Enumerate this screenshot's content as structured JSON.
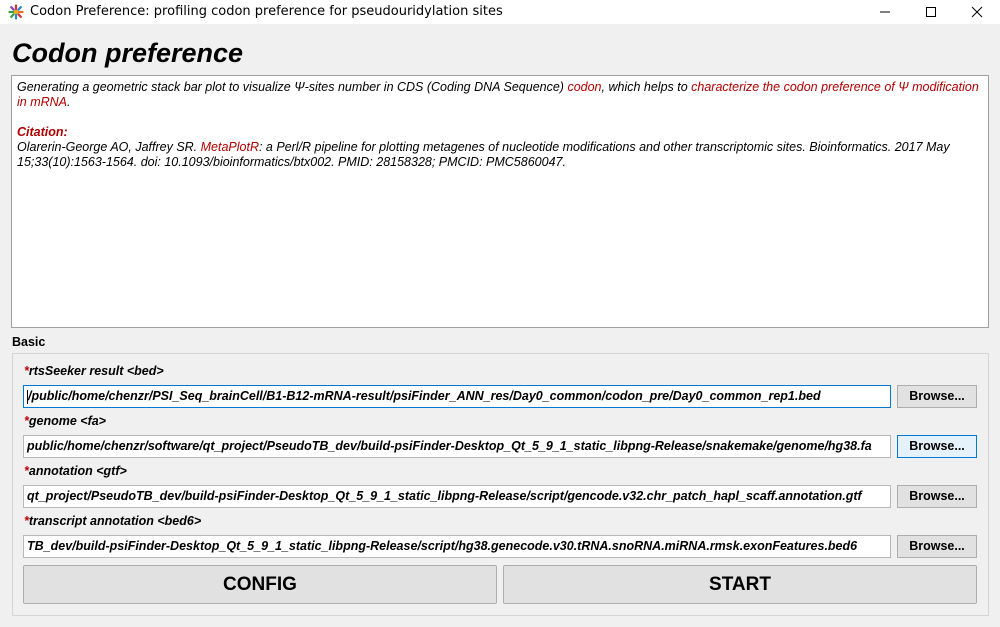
{
  "window": {
    "title": "Codon Preference: profiling codon preference for pseudouridylation sites"
  },
  "page": {
    "title": "Codon preference"
  },
  "description": {
    "line1_a": "Generating a geometric stack bar plot to visualize Ψ-sites number in CDS (Coding DNA Sequence) ",
    "line1_codon": "codon",
    "line1_b": ", which helps to ",
    "line1_char": "characterize the codon preference of Ψ modification in mRNA",
    "line1_end": ".",
    "citation_label": "Citation:",
    "citation_authors": "Olarerin-George AO, Jaffrey SR. ",
    "citation_tool": "MetaPlotR",
    "citation_rest": ": a Perl/R pipeline for plotting metagenes of nucleotide modifications and other transcriptomic sites. Bioinformatics. 2017 May 15;33(10):1563-1564. doi: 10.1093/bioinformatics/btx002. PMID: 28158328; PMCID: PMC5860047."
  },
  "basic": {
    "label": "Basic",
    "fields": [
      {
        "label": "rtsSeeker result <bed>",
        "value": "/public/home/chenzr/PSI_Seq_brainCell/B1-B12-mRNA-result/psiFinder_ANN_res/Day0_common/codon_pre/Day0_common_rep1.bed"
      },
      {
        "label": "genome <fa>",
        "value": "public/home/chenzr/software/qt_project/PseudoTB_dev/build-psiFinder-Desktop_Qt_5_9_1_static_libpng-Release/snakemake/genome/hg38.fa"
      },
      {
        "label": "annotation <gtf>",
        "value": "qt_project/PseudoTB_dev/build-psiFinder-Desktop_Qt_5_9_1_static_libpng-Release/script/gencode.v32.chr_patch_hapl_scaff.annotation.gtf"
      },
      {
        "label": "transcript annotation <bed6>",
        "value": "TB_dev/build-psiFinder-Desktop_Qt_5_9_1_static_libpng-Release/script/hg38.genecode.v30.tRNA.snoRNA.miRNA.rmsk.exonFeatures.bed6"
      }
    ],
    "required_mark": "*",
    "browse_label": "Browse..."
  },
  "actions": {
    "config_label": "CONFIG",
    "start_label": "START"
  },
  "colors": {
    "accent_red": "#b00000",
    "focus_blue": "#0078d7"
  }
}
